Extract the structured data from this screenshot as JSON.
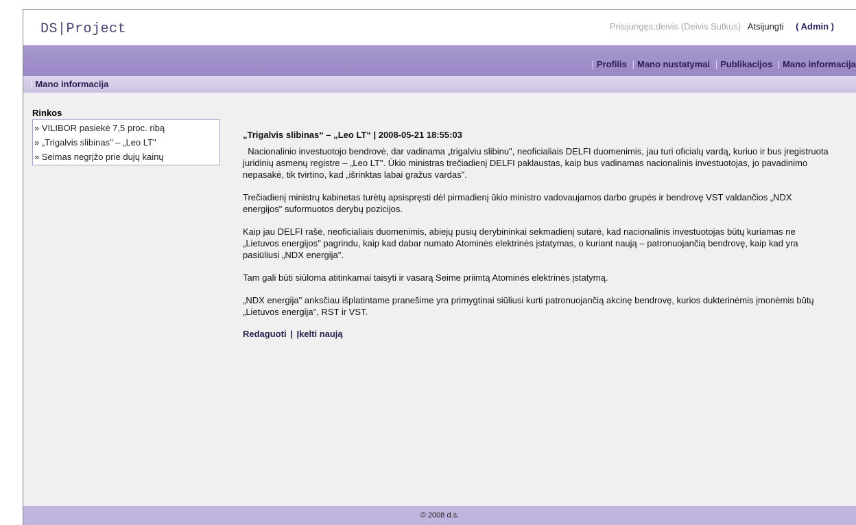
{
  "header": {
    "logo": "DS|Project",
    "logged_in": "Prisijungęs:deivis (Deivis Sutkus)",
    "logout": "Atsijungti",
    "role": "( Admin )"
  },
  "nav": {
    "items": [
      "Profilis",
      "Mano nustatymai",
      "Publikacijos",
      "Mano informacija"
    ]
  },
  "subbar": {
    "title": "Mano informacija"
  },
  "sidebar": {
    "title": "Rinkos",
    "items": [
      "» VILIBOR pasiekė 7,5 proc. ribą",
      "» „Trigalvis slibinas\" – „Leo LT\"",
      "» Seimas negrįžo prie dujų kainų"
    ]
  },
  "article": {
    "title": "„Trigalvis slibinas“ – „Leo LT“ | 2008-05-21 18:55:03",
    "paragraphs": [
      "  Nacionalinio investuotojo bendrovė, dar vadinama „trigalviu slibinu\", neoficialiais DELFI duomenimis, jau turi oficialų vardą, kuriuo ir bus įregistruota juridinių asmenų registre – „Leo LT\". Ūkio ministras trečiadienį DELFI paklaustas, kaip bus vadinamas nacionalinis investuotojas, jo pavadinimo nepasakė, tik tvirtino, kad „išrinktas labai gražus vardas\".",
      "Trečiadienį ministrų kabinetas turėtų apsispręsti dėl pirmadienį ūkio ministro vadovaujamos darbo grupės ir bendrovę VST valdančios „NDX energijos\" suformuotos derybų pozicijos.",
      "Kaip jau DELFI rašė, neoficialiais duomenimis, abiejų pusių derybininkai sekmadienį sutarė, kad nacionalinis investuotojas būtų kuriamas ne „Lietuvos energijos\" pagrindu, kaip kad dabar numato Atominės elektrinės įstatymas, o kuriant naują – patronuojančią bendrovę, kaip kad yra pasiūliusi „NDX energija\".",
      "Tam gali būti siūloma atitinkamai taisyti ir vasarą Seime priimtą Atominės elektrinės įstatymą.",
      "„NDX energija\" anksčiau išplatintame pranešime yra primygtinai siūliusi kurti patronuojančią akcinę bendrovę, kurios dukterinėmis įmonėmis būtų „Lietuvos energija\", RST ir VST."
    ],
    "edit_link": "Redaguoti",
    "separator": "|",
    "upload_link": "Įkelti naują"
  },
  "footer": {
    "text": "© 2008 d.s."
  }
}
